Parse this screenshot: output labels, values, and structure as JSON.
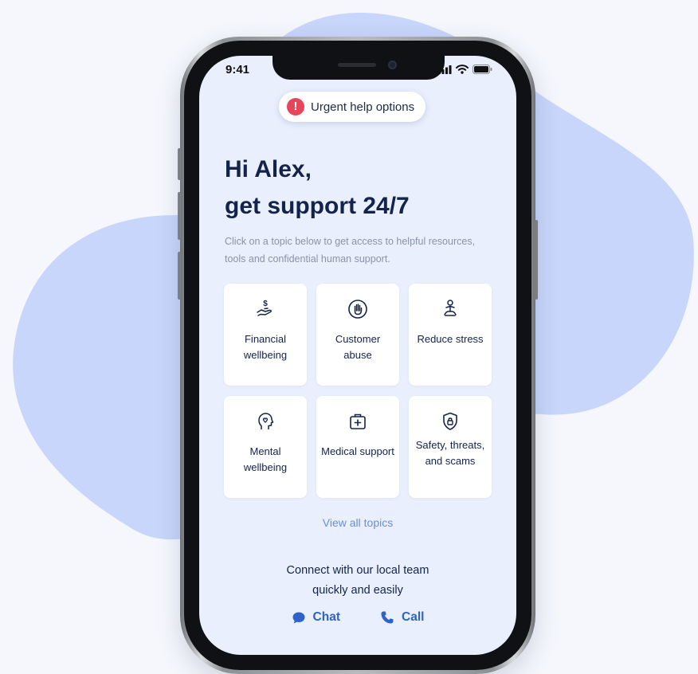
{
  "status_bar": {
    "time": "9:41",
    "icons": [
      "signal-icon",
      "wifi-icon",
      "battery-icon"
    ]
  },
  "urgent": {
    "label": "Urgent help options",
    "icon": "alert-icon",
    "color": "#e8445a"
  },
  "greeting": {
    "line1": "Hi Alex,",
    "line2": "get support 24/7"
  },
  "intro": "Click on a topic below to get access to helpful resources, tools and confidential human support.",
  "topics": [
    {
      "label": "Financial wellbeing",
      "icon": "hand-dollar-icon"
    },
    {
      "label": "Customer abuse",
      "icon": "hand-stop-icon"
    },
    {
      "label": "Reduce stress",
      "icon": "meditation-icon"
    },
    {
      "label": "Mental wellbeing",
      "icon": "head-heart-icon"
    },
    {
      "label": "Medical support",
      "icon": "medical-kit-icon"
    },
    {
      "label": "Safety, threats, and scams",
      "icon": "shield-lock-icon"
    }
  ],
  "view_all": "View all topics",
  "connect": {
    "line1": "Connect with our local team",
    "line2": "quickly and easily"
  },
  "actions": {
    "chat": "Chat",
    "call": "Call"
  },
  "colors": {
    "background": "#f5f7fd",
    "blob": "#c9d6fb",
    "screen": "#e9effd",
    "heading": "#14234b",
    "link": "#6d8fcf",
    "action": "#2f62c9"
  }
}
